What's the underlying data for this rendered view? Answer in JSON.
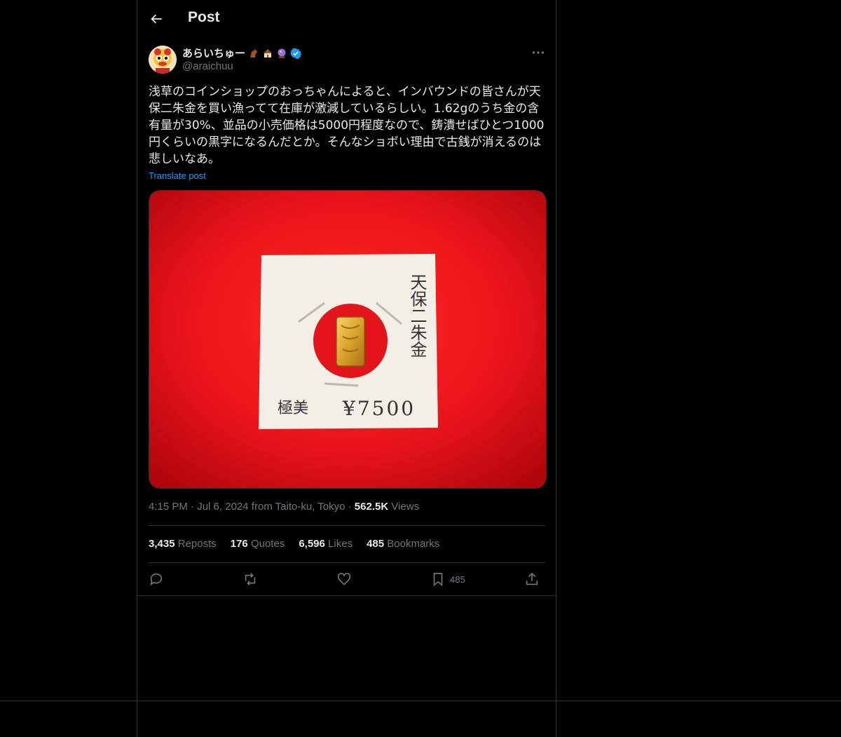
{
  "header": {
    "title": "Post",
    "back_icon": "arrow-left-icon"
  },
  "author": {
    "display_name": "あらいちゅー",
    "handle": "@araichuu",
    "verified": true,
    "emojis": [
      "horse-emoji",
      "house-emoji",
      "crystal-ball-emoji"
    ]
  },
  "post": {
    "text": "浅草のコインショップのおっちゃんによると、インバウンドの皆さんが天保二朱金を買い漁ってて在庫が激減しているらしい。1.62gのうち金の含有量が30%、並品の小売価格は5000円程度なので、鋳潰せばひとつ1000円くらいの黒字になるんだとか。そんなショボい理由で古銭が消えるのは悲しいなあ。",
    "translate_label": "Translate post",
    "image": {
      "card_text_vertical": "天保二朱金",
      "grade_label": "極美",
      "price_label": "¥7500"
    },
    "time": "4:15 PM",
    "date_location": "Jul 6, 2024 from Taito-ku, Tokyo",
    "views_count": "562.5K",
    "views_label": "Views"
  },
  "stats": {
    "reposts_count": "3,435",
    "reposts_label": "Reposts",
    "quotes_count": "176",
    "quotes_label": "Quotes",
    "likes_count": "6,596",
    "likes_label": "Likes",
    "bookmarks_count": "485",
    "bookmarks_label": "Bookmarks"
  },
  "actions": {
    "bookmark_count": "485"
  },
  "colors": {
    "accent": "#1d9bf0",
    "muted": "#71767b",
    "border": "#2f3336",
    "media_red": "#e8141a"
  }
}
